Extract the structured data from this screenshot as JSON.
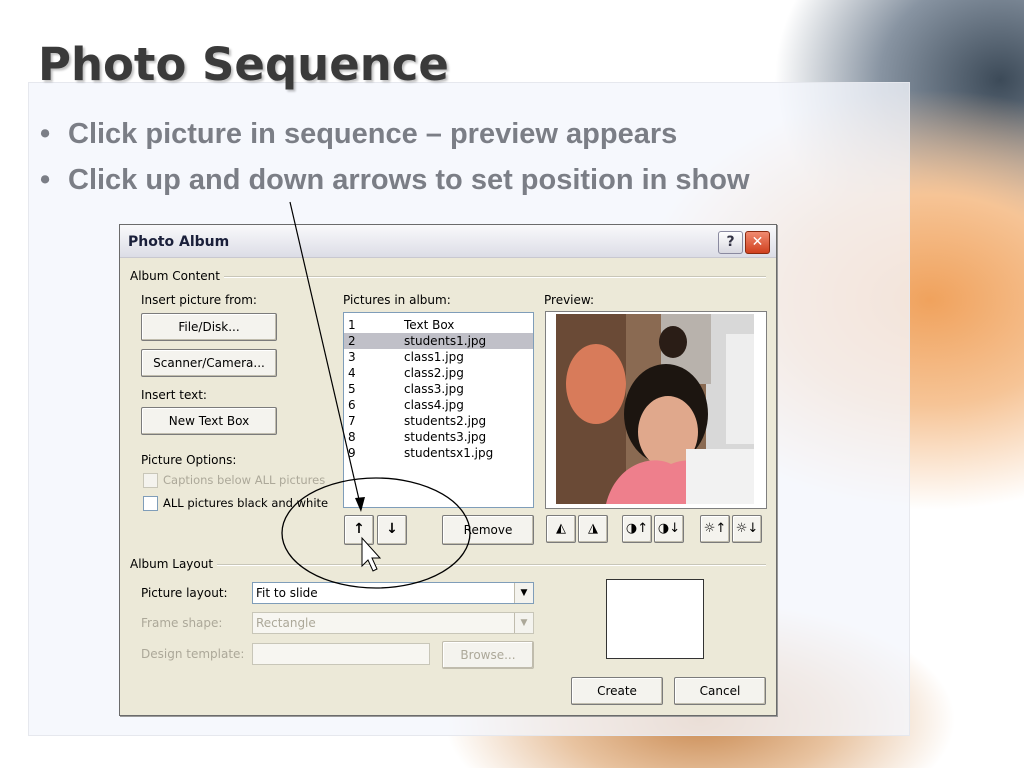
{
  "slide": {
    "title": "Photo Sequence",
    "bullets": [
      "Click picture in sequence – preview appears",
      "Click up and down arrows to set position in show"
    ]
  },
  "dialog": {
    "title": "Photo Album",
    "help_label": "?",
    "close_label": "✕",
    "album_content": {
      "group_label": "Album Content",
      "insert_picture_label": "Insert picture from:",
      "file_disk_button": "File/Disk...",
      "scanner_camera_button": "Scanner/Camera...",
      "insert_text_label": "Insert text:",
      "new_text_box_button": "New Text Box",
      "picture_options_label": "Picture Options:",
      "captions_option": "Captions below ALL pictures",
      "black_white_option": "ALL pictures black and white",
      "pictures_in_album_label": "Pictures in album:",
      "pictures": [
        {
          "num": "1",
          "name": "Text Box"
        },
        {
          "num": "2",
          "name": "students1.jpg"
        },
        {
          "num": "3",
          "name": "class1.jpg"
        },
        {
          "num": "4",
          "name": "class2.jpg"
        },
        {
          "num": "5",
          "name": "class3.jpg"
        },
        {
          "num": "6",
          "name": "class4.jpg"
        },
        {
          "num": "7",
          "name": "students2.jpg"
        },
        {
          "num": "8",
          "name": "students3.jpg"
        },
        {
          "num": "9",
          "name": "studentsx1.jpg"
        }
      ],
      "selected_index": 1,
      "move_up_glyph": "↑",
      "move_down_glyph": "↓",
      "remove_button": "Remove",
      "preview_label": "Preview:"
    },
    "album_layout": {
      "group_label": "Album Layout",
      "picture_layout_label": "Picture layout:",
      "picture_layout_value": "Fit to slide",
      "frame_shape_label": "Frame shape:",
      "frame_shape_value": "Rectangle",
      "design_template_label": "Design template:",
      "design_template_value": "",
      "browse_button": "Browse..."
    },
    "create_button": "Create",
    "cancel_button": "Cancel"
  },
  "colors": {
    "title": "#3a3a3a",
    "bullet_text": "#7b7e86",
    "dialog_bg": "#ece9d8",
    "close_button": "#d0401e"
  }
}
